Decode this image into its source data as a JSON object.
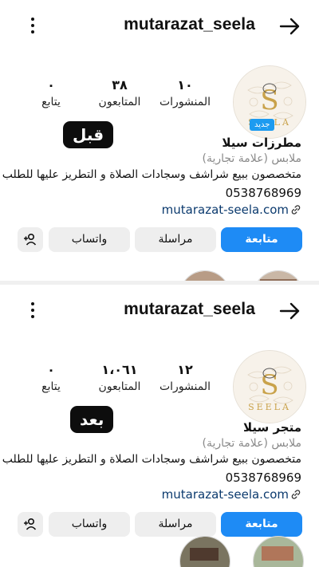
{
  "panels": [
    {
      "username": "mutarazat_seela",
      "avatar": {
        "brand_text": "SEELA",
        "new_badge": "جديد"
      },
      "stats": {
        "posts": {
          "value": "١٠",
          "label": "المنشورات"
        },
        "followers": {
          "value": "٣٨",
          "label": "المتابعون"
        },
        "following": {
          "value": "٠",
          "label": "يتابع"
        }
      },
      "tag": "قبل",
      "display_name": "مطرزات سيلا",
      "category": "ملابس (علامة تجارية)",
      "bio": "متخصصون ببيع شراشف وسجادات الصلاة و التطريز عليها للطلب",
      "phone": "0538768969",
      "website": "mutarazat-seela.com",
      "buttons": {
        "follow": "متابعة",
        "message": "مراسلة",
        "whatsapp": "واتساب"
      }
    },
    {
      "username": "mutarazat_seela",
      "avatar": {
        "brand_text": "SEELA"
      },
      "stats": {
        "posts": {
          "value": "١٢",
          "label": "المنشورات"
        },
        "followers": {
          "value": "١،٠٦١",
          "label": "المتابعون"
        },
        "following": {
          "value": "٠",
          "label": "يتابع"
        }
      },
      "tag": "بعد",
      "display_name": "متجر سيلا",
      "category": "ملابس (علامة تجارية)",
      "bio": "متخصصون ببيع شراشف وسجادات الصلاة و التطريز عليها للطلب",
      "phone": "0538768969",
      "website": "mutarazat-seela.com",
      "buttons": {
        "follow": "متابعة",
        "message": "مراسلة",
        "whatsapp": "واتساب"
      }
    }
  ],
  "colors": {
    "accent": "#1e8bf5",
    "link": "#0b3a6e",
    "badge": "#1d9bf0",
    "logo_gold": "#c9a24a"
  },
  "icons": [
    "more-vertical-icon",
    "back-arrow-icon",
    "link-icon",
    "add-user-icon"
  ]
}
